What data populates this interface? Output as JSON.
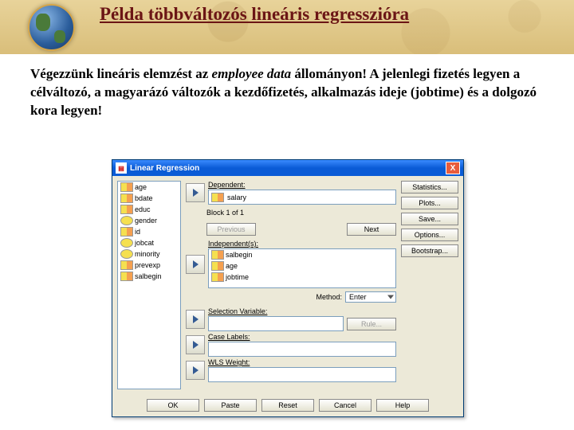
{
  "slide": {
    "title": "Példa többváltozós lineáris regresszióra",
    "body_prefix": "Végezzünk lineáris elemzést az ",
    "body_em": "employee data",
    "body_suffix": " állományon! A jelenlegi fizetés legyen a célváltozó, a magyarázó változók a kezdőfizetés, alkalmazás ideje (jobtime) és a dolgozó kora legyen!"
  },
  "dialog": {
    "title": "Linear Regression",
    "close": "X",
    "vars": [
      {
        "name": "age",
        "type": "scale"
      },
      {
        "name": "bdate",
        "type": "scale"
      },
      {
        "name": "educ",
        "type": "scale"
      },
      {
        "name": "gender",
        "type": "nominal"
      },
      {
        "name": "id",
        "type": "scale"
      },
      {
        "name": "jobcat",
        "type": "nominal"
      },
      {
        "name": "minority",
        "type": "nominal"
      },
      {
        "name": "prevexp",
        "type": "scale"
      },
      {
        "name": "salbegin",
        "type": "scale"
      }
    ],
    "labels": {
      "dependent": "Dependent:",
      "block": "Block 1 of 1",
      "previous": "Previous",
      "next": "Next",
      "independent": "Independent(s):",
      "method": "Method:",
      "method_value": "Enter",
      "selection_var": "Selection Variable:",
      "rule": "Rule...",
      "case_labels": "Case Labels:",
      "wls_weight": "WLS Weight:"
    },
    "dependent_value": "salary",
    "independents": [
      {
        "name": "salbegin",
        "type": "scale"
      },
      {
        "name": "age",
        "type": "scale"
      },
      {
        "name": "jobtime",
        "type": "scale"
      }
    ],
    "side_buttons": {
      "statistics": "Statistics...",
      "plots": "Plots...",
      "save": "Save...",
      "options": "Options...",
      "bootstrap": "Bootstrap..."
    },
    "footer": {
      "ok": "OK",
      "paste": "Paste",
      "reset": "Reset",
      "cancel": "Cancel",
      "help": "Help"
    }
  }
}
